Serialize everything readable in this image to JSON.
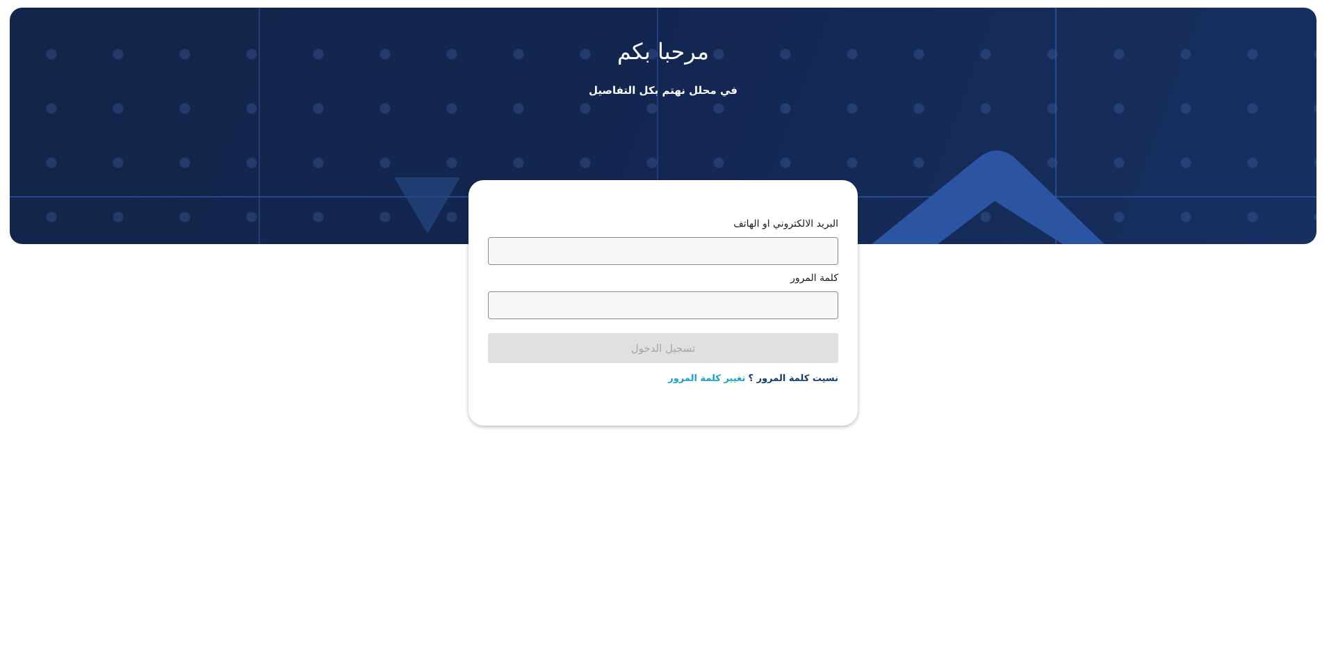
{
  "hero": {
    "title": "مرحبا بكم",
    "subtitle": "في محلل نهتم بكل التفاصيل"
  },
  "login_form": {
    "email_label": "البريد الالكتروني او الهاتف",
    "email_value": "",
    "password_label": "كلمة المرور",
    "password_value": "",
    "login_button_label": "تسجيل الدخول",
    "forgot_text": "نسيت كلمة المرور ؟",
    "change_password_link": "تغيير كلمة المرور"
  },
  "colors": {
    "hero_background": "#14254a",
    "accent_shape": "#2b55a3",
    "link_accent": "#18a3c4",
    "disabled_button": "#e0e0e0"
  }
}
